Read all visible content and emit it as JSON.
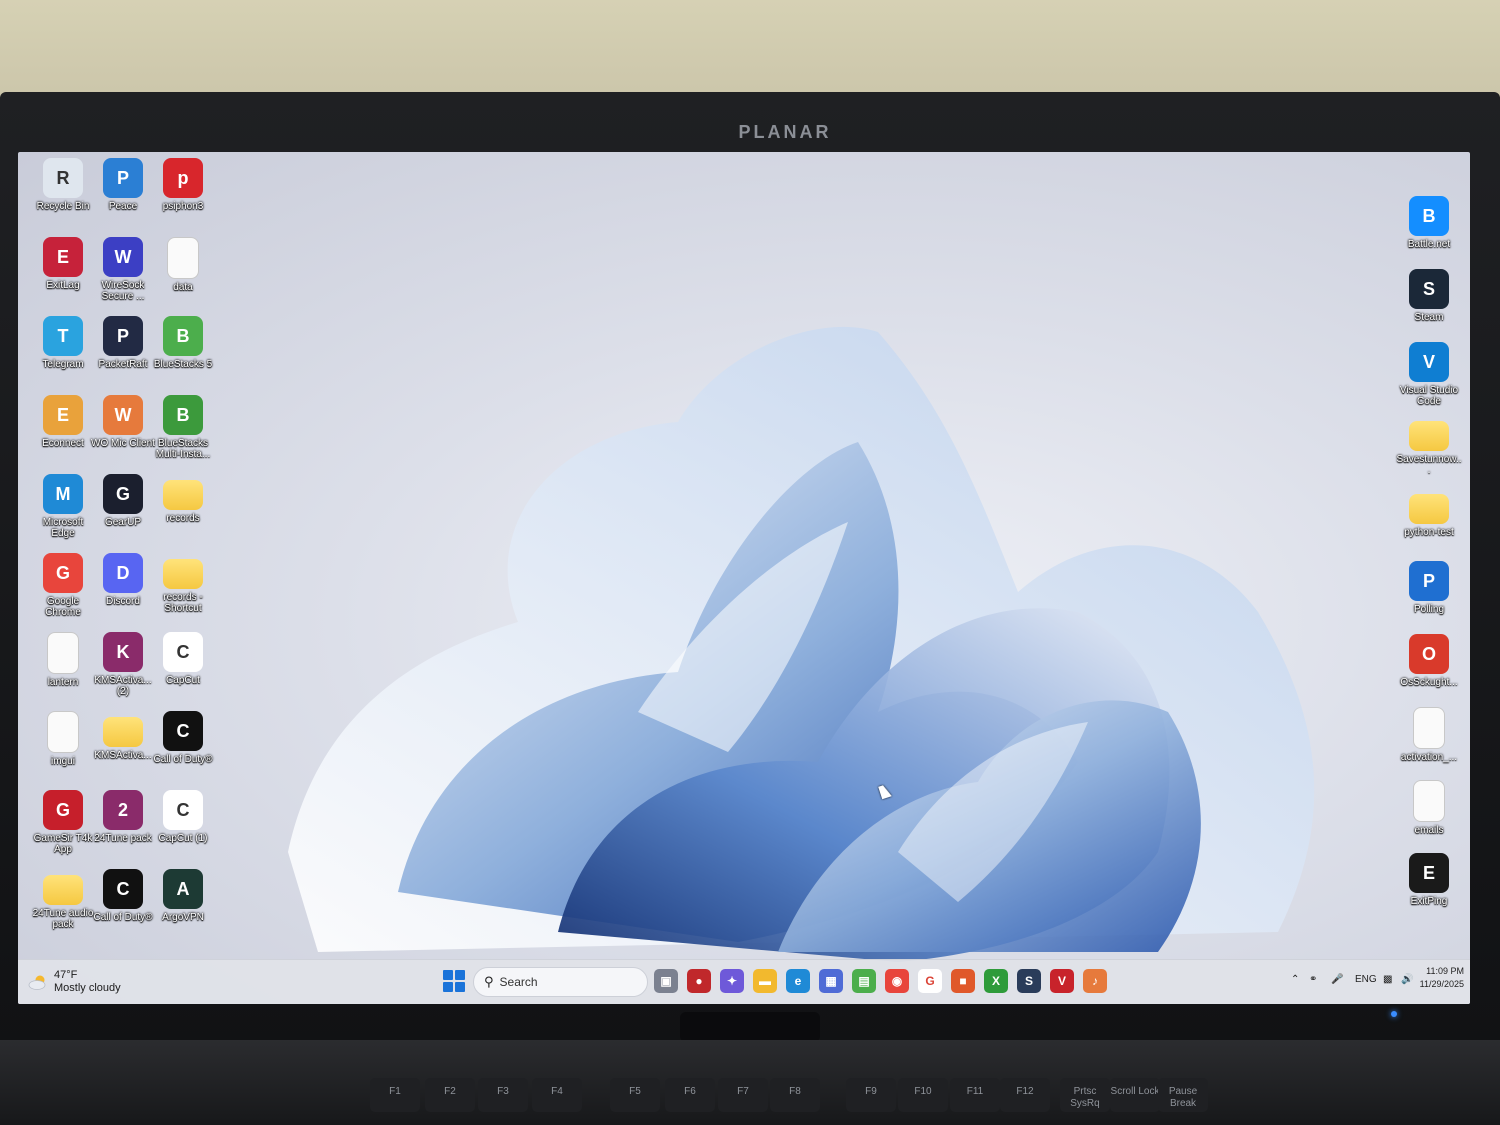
{
  "monitor": {
    "brand": "PLANAR"
  },
  "desktop_icons_left": [
    {
      "label": "Recycle Bin",
      "icon": "recycle-bin-icon",
      "color": "#dfe6ee"
    },
    {
      "label": "Peace",
      "icon": "peace-icon",
      "color": "#2b7fd4"
    },
    {
      "label": "psiphon3",
      "icon": "psiphon-icon",
      "color": "#d8262c"
    },
    {
      "label": "ExitLag",
      "icon": "exitlag-icon",
      "color": "#c6223a"
    },
    {
      "label": "WireSock Secure ...",
      "icon": "wiresock-icon",
      "color": "#3c3fc4"
    },
    {
      "label": "data",
      "icon": "document-icon",
      "color": "#fafafa"
    },
    {
      "label": "Telegram",
      "icon": "telegram-icon",
      "color": "#2aa3df"
    },
    {
      "label": "PacketRaft",
      "icon": "packetraft-icon",
      "color": "#222a44"
    },
    {
      "label": "BlueStacks 5",
      "icon": "bluestacks-icon",
      "color": "#4cae4c"
    },
    {
      "label": "Econnect",
      "icon": "econnect-icon",
      "color": "#e9a23b"
    },
    {
      "label": "WO Mic Client",
      "icon": "microphone-icon",
      "color": "#e67a3c"
    },
    {
      "label": "BlueStacks Multi-Insta...",
      "icon": "bluestacks-multi-icon",
      "color": "#3c9a3c"
    },
    {
      "label": "Microsoft Edge",
      "icon": "edge-icon",
      "color": "#1f8ad6"
    },
    {
      "label": "GearUP",
      "icon": "gearup-icon",
      "color": "#1b1f2e"
    },
    {
      "label": "records",
      "icon": "folder-icon",
      "color": "#f5c841"
    },
    {
      "label": "Google Chrome",
      "icon": "chrome-icon",
      "color": "#e8453c"
    },
    {
      "label": "Discord",
      "icon": "discord-icon",
      "color": "#5865f2"
    },
    {
      "label": "records - Shortcut",
      "icon": "folder-icon",
      "color": "#f5c841"
    },
    {
      "label": "lantern",
      "icon": "document-icon",
      "color": "#fafafa"
    },
    {
      "label": "KMSActiva... (2)",
      "icon": "winrar-icon",
      "color": "#8a2b6a"
    },
    {
      "label": "CapCut",
      "icon": "capcut-icon",
      "color": "#ffffff"
    },
    {
      "label": "imgui",
      "icon": "document-icon",
      "color": "#fafafa"
    },
    {
      "label": "KMSActiva...",
      "icon": "folder-icon",
      "color": "#f5c841"
    },
    {
      "label": "Call of Duty®",
      "icon": "call-of-duty-icon",
      "color": "#111111"
    },
    {
      "label": "GameSir T4k App",
      "icon": "gamesir-icon",
      "color": "#c61f2b"
    },
    {
      "label": "24Tune pack",
      "icon": "winrar-icon",
      "color": "#8a2b6a"
    },
    {
      "label": "CapCut (1)",
      "icon": "capcut-icon",
      "color": "#ffffff"
    },
    {
      "label": "24Tune audio pack",
      "icon": "folder-icon",
      "color": "#f5c841"
    },
    {
      "label": "Call of Duty®",
      "icon": "call-of-duty-icon",
      "color": "#111111"
    },
    {
      "label": "ArgoVPN",
      "icon": "argovpn-icon",
      "color": "#1d3a34"
    }
  ],
  "desktop_icons_right": [
    {
      "label": "Battle.net",
      "icon": "battlenet-icon",
      "color": "#148eff"
    },
    {
      "label": "Steam",
      "icon": "steam-icon",
      "color": "#1b2838"
    },
    {
      "label": "Visual Studio Code",
      "icon": "vscode-icon",
      "color": "#0f7ed2"
    },
    {
      "label": "Savestunnow...",
      "icon": "folder-icon",
      "color": "#f5c841"
    },
    {
      "label": "python-test",
      "icon": "folder-icon",
      "color": "#f5c841"
    },
    {
      "label": "Polling",
      "icon": "gamepad-icon",
      "color": "#1f6fd1"
    },
    {
      "label": "OsSckught...",
      "icon": "pdf-icon",
      "color": "#d93a2b"
    },
    {
      "label": "activation_...",
      "icon": "document-icon",
      "color": "#fafafa"
    },
    {
      "label": "emails",
      "icon": "document-icon",
      "color": "#fafafa"
    },
    {
      "label": "ExitPing",
      "icon": "exitping-icon",
      "color": "#1a1a1a"
    }
  ],
  "taskbar": {
    "weather": {
      "temp": "47°F",
      "condition": "Mostly cloudy"
    },
    "search_placeholder": "Search",
    "pinned_apps": [
      {
        "name": "task-view-icon",
        "color": "#7b8190",
        "glyph": "▣"
      },
      {
        "name": "app-red-icon",
        "color": "#c0282b",
        "glyph": "●"
      },
      {
        "name": "copilot-icon",
        "color": "#6e59d9",
        "glyph": "✦"
      },
      {
        "name": "file-explorer-icon",
        "color": "#f2b92e",
        "glyph": "▬"
      },
      {
        "name": "edge-icon",
        "color": "#1f8ad6",
        "glyph": "e"
      },
      {
        "name": "store-icon",
        "color": "#4f6bd6",
        "glyph": "▦"
      },
      {
        "name": "bluestacks-icon",
        "color": "#4cae4c",
        "glyph": "▤"
      },
      {
        "name": "chrome-icon",
        "color": "#e8453c",
        "glyph": "◉"
      },
      {
        "name": "google-icon",
        "color": "#ffffff",
        "glyph": "G"
      },
      {
        "name": "app-orange-icon",
        "color": "#e0582a",
        "glyph": "■"
      },
      {
        "name": "xbox-icon",
        "color": "#2e9b3a",
        "glyph": "X"
      },
      {
        "name": "steam-icon",
        "color": "#2a3c5a",
        "glyph": "S"
      },
      {
        "name": "voice-app-icon",
        "color": "#c8232b",
        "glyph": "V"
      },
      {
        "name": "wo-mic-icon",
        "color": "#e67a3c",
        "glyph": "♪"
      }
    ],
    "tray": {
      "language": "ENG",
      "time": "11:09 PM",
      "date": "11/29/2025"
    }
  },
  "keyboard_keys": [
    "F1",
    "F2",
    "F3",
    "F4",
    "F5",
    "F6",
    "F7",
    "F8",
    "F9",
    "F10",
    "F11",
    "F12",
    "Prtsc SysRq",
    "Scroll Lock",
    "Pause Break"
  ]
}
